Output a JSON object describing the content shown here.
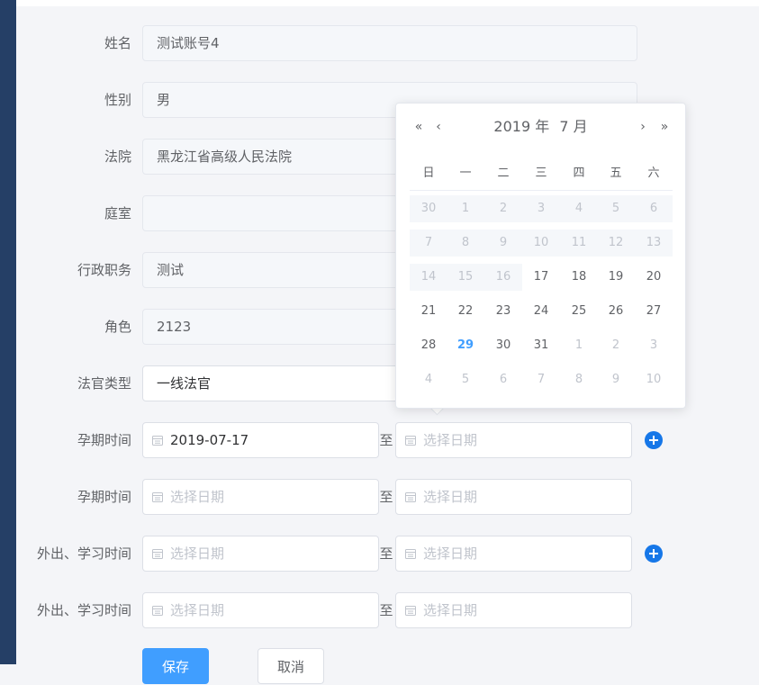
{
  "form": {
    "name": {
      "label": "姓名",
      "value": "测试账号4"
    },
    "gender": {
      "label": "性别",
      "value": "男"
    },
    "court": {
      "label": "法院",
      "value": "黑龙江省高级人民法院"
    },
    "chamber": {
      "label": "庭室",
      "value": ""
    },
    "position": {
      "label": "行政职务",
      "value": "测试"
    },
    "role": {
      "label": "角色",
      "value": "2123"
    },
    "judge_type": {
      "label": "法官类型",
      "value": "一线法官"
    },
    "date_rows": [
      {
        "label": "孕期时间",
        "start": "2019-07-17",
        "end": "",
        "has_add": true
      },
      {
        "label": "孕期时间",
        "start": "",
        "end": "",
        "has_add": false
      },
      {
        "label": "外出、学习时间",
        "start": "",
        "end": "",
        "has_add": true
      },
      {
        "label": "外出、学习时间",
        "start": "",
        "end": "",
        "has_add": false
      }
    ],
    "range_separator": "至",
    "date_placeholder": "选择日期"
  },
  "buttons": {
    "save": "保存",
    "cancel": "取消"
  },
  "picker": {
    "year_text": "2019 年",
    "month_text": "7 月",
    "nav": {
      "prev_year": "«",
      "prev_month": "‹",
      "next_month": "›",
      "next_year": "»"
    },
    "weekdays": [
      "日",
      "一",
      "二",
      "三",
      "四",
      "五",
      "六"
    ],
    "days": [
      [
        "30",
        "1",
        "2",
        "3",
        "4",
        "5",
        "6"
      ],
      [
        "7",
        "8",
        "9",
        "10",
        "11",
        "12",
        "13"
      ],
      [
        "14",
        "15",
        "16",
        "17",
        "18",
        "19",
        "20"
      ],
      [
        "21",
        "22",
        "23",
        "24",
        "25",
        "26",
        "27"
      ],
      [
        "28",
        "29",
        "30",
        "31",
        "1",
        "2",
        "3"
      ],
      [
        "4",
        "5",
        "6",
        "7",
        "8",
        "9",
        "10"
      ]
    ],
    "today": "29"
  },
  "colors": {
    "sidebar": "#253f66",
    "primary": "#409eff",
    "add_icon": "#1677e8"
  }
}
